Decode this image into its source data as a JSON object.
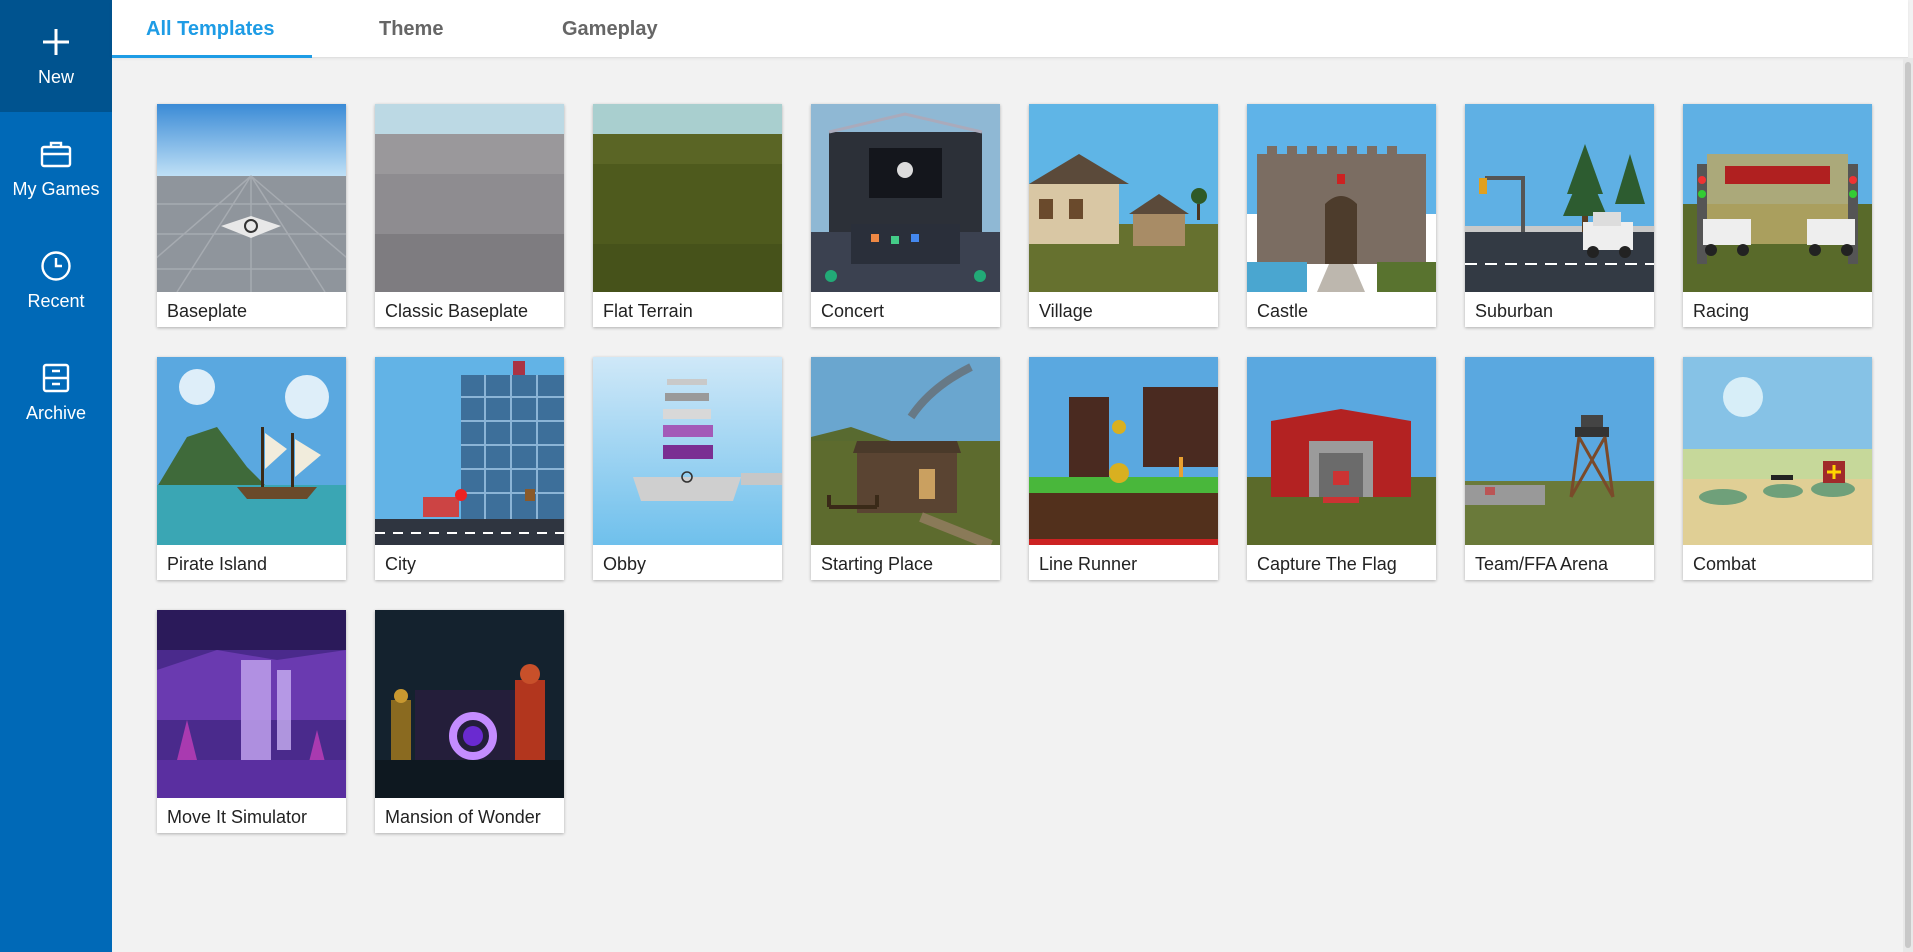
{
  "sidebar": {
    "items": [
      {
        "label": "New",
        "icon": "plus-icon"
      },
      {
        "label": "My Games",
        "icon": "briefcase-icon"
      },
      {
        "label": "Recent",
        "icon": "clock-icon"
      },
      {
        "label": "Archive",
        "icon": "archive-box-icon"
      }
    ]
  },
  "tabs": [
    {
      "label": "All Templates",
      "active": true
    },
    {
      "label": "Theme",
      "active": false
    },
    {
      "label": "Gameplay",
      "active": false
    }
  ],
  "templates": [
    {
      "label": "Baseplate"
    },
    {
      "label": "Classic Baseplate"
    },
    {
      "label": "Flat Terrain"
    },
    {
      "label": "Concert"
    },
    {
      "label": "Village"
    },
    {
      "label": "Castle"
    },
    {
      "label": "Suburban"
    },
    {
      "label": "Racing"
    },
    {
      "label": "Pirate Island"
    },
    {
      "label": "City"
    },
    {
      "label": "Obby"
    },
    {
      "label": "Starting Place"
    },
    {
      "label": "Line Runner"
    },
    {
      "label": "Capture The Flag"
    },
    {
      "label": "Team/FFA Arena"
    },
    {
      "label": "Combat"
    },
    {
      "label": "Move It Simulator"
    },
    {
      "label": "Mansion of Wonder"
    }
  ],
  "colors": {
    "sidebar": "#0069b7",
    "sidebar_active": "#00538f",
    "accent": "#1e9ce5",
    "background": "#f2f2f2"
  }
}
